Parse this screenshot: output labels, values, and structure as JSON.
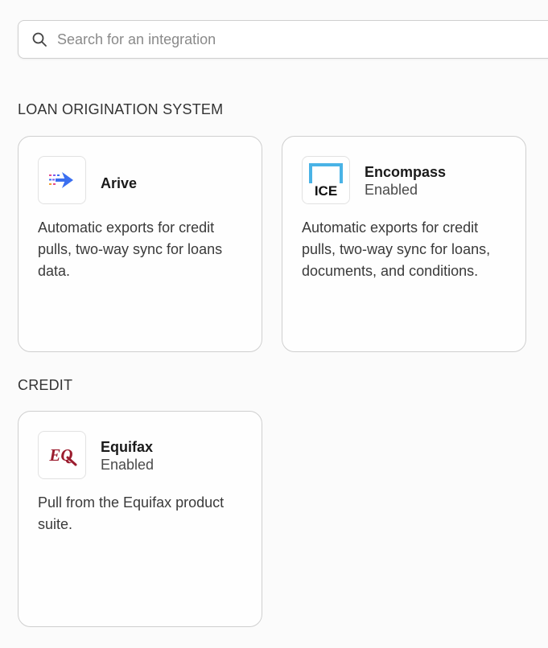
{
  "search": {
    "placeholder": "Search for an integration",
    "value": ""
  },
  "sections": [
    {
      "title": "LOAN ORIGINATION SYSTEM",
      "cards": [
        {
          "name": "Arive",
          "status": "",
          "description": "Automatic exports for credit pulls, two-way sync for loans data.",
          "logo": "arive-logo"
        },
        {
          "name": "Encompass",
          "status": "Enabled",
          "description": "Automatic exports for credit pulls, two-way sync for loans, documents, and conditions.",
          "logo": "ice-logo",
          "logo_text": "ICE"
        }
      ]
    },
    {
      "title": "CREDIT",
      "cards": [
        {
          "name": "Equifax",
          "status": "Enabled",
          "description": "Pull from the Equifax product suite.",
          "logo": "equifax-logo",
          "logo_text": "EQ"
        }
      ]
    }
  ],
  "colors": {
    "ice_blue": "#4ab3e6",
    "arive_blue": "#3b6ff0",
    "equifax_red": "#9b1c2e"
  }
}
